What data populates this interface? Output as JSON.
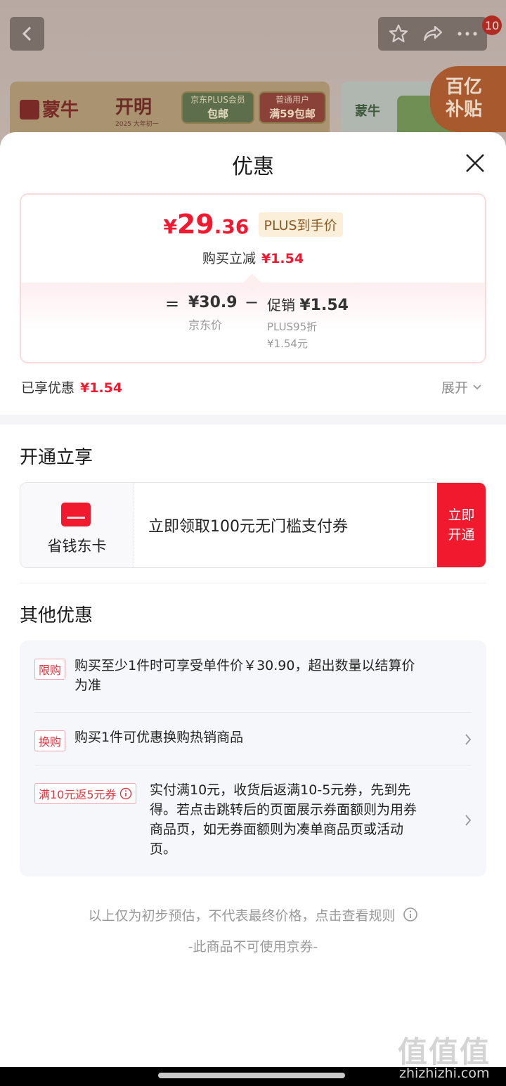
{
  "background": {
    "badge_count": "10",
    "banner": {
      "brand": "蒙牛",
      "calligraphy": "开明",
      "calligraphy_sub": "2025 大年初一",
      "plus_tag_top": "京东PLUS会员",
      "plus_tag_bottom": "包邮",
      "user_tag_top": "普通用户",
      "user_tag_bottom": "满59包邮"
    },
    "banner2_brand": "蒙牛",
    "subsidy_line1": "百亿",
    "subsidy_line2": "补贴"
  },
  "sheet": {
    "title": "优惠",
    "price_card": {
      "currency": "¥",
      "price_int": "29",
      "price_dec": ".36",
      "plus_label": "PLUS到手价",
      "reduce_label": "购买立减",
      "reduce_amount": "¥1.54",
      "equals": "=",
      "base_value": "¥30.9",
      "base_label": "京东价",
      "minus": "−",
      "promo_label": "促销",
      "promo_value": "¥1.54",
      "promo_detail_1": "PLUS95折",
      "promo_detail_2": "¥1.54元"
    },
    "enjoyed_label": "已享优惠",
    "enjoyed_amount": "¥1.54",
    "expand_label": "展开",
    "open_section": {
      "title": "开通立享",
      "card_name": "省钱东卡",
      "card_desc": "立即领取100元无门槛支付券",
      "button_line1": "立即",
      "button_line2": "开通"
    },
    "other_section": {
      "title": "其他优惠",
      "items": [
        {
          "tag": "限购",
          "text_line1": "购买至少1件时可享受单件价￥30.90，超出数量以结算价",
          "text_line2": "为准"
        },
        {
          "tag": "换购",
          "text_line1": "购买1件可优惠换购热销商品"
        },
        {
          "tag": "满10元返5元券",
          "text_line1": "实付满10元，收货后返满10-5元券，先到先",
          "text_line2": "得。若点击跳转后的页面展示券面额则为用券",
          "text_line3": "商品页，如无券面额则为凑单商品页或活动",
          "text_line4": "页。"
        }
      ]
    },
    "footnote": "以上仅为初步预估，不代表最终价格，点击查看规则",
    "footnote2": "-此商品不可使用京券-"
  },
  "watermark": "值值值",
  "watermark_url": "zhizhizhi.com",
  "colors": {
    "accent": "#f2182f",
    "plus_bg": "#fbefd9",
    "card_bg": "#f6f7fb"
  },
  "icons": [
    "back-icon",
    "star-icon",
    "share-icon",
    "more-icon",
    "close-icon",
    "chevron-down-icon",
    "card-icon",
    "info-icon",
    "chevron-right-icon"
  ]
}
